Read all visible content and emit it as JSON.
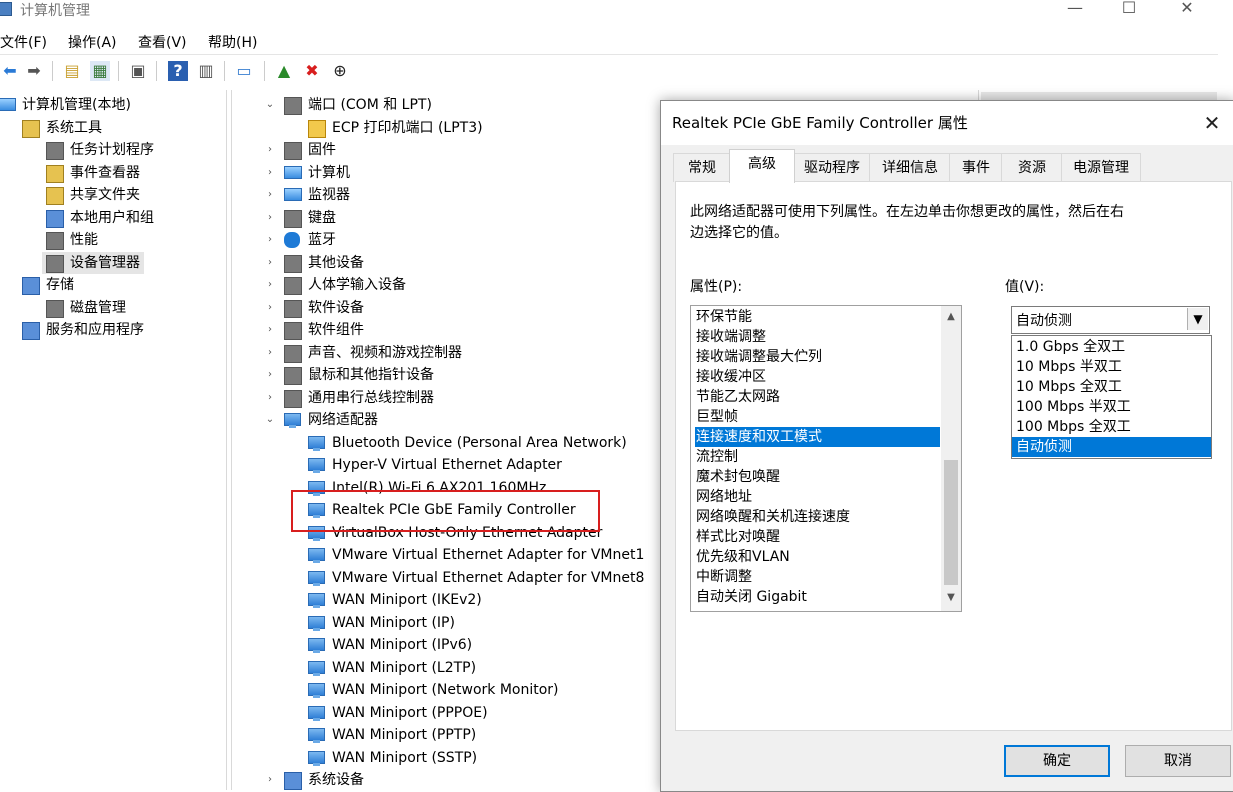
{
  "window": {
    "title": "计算机管理"
  },
  "menu": [
    "文件(F)",
    "操作(A)",
    "查看(V)",
    "帮助(H)"
  ],
  "tree_left": [
    {
      "label": "计算机管理(本地)",
      "level": 0,
      "expander": "",
      "icon": "computer-management-icon"
    },
    {
      "label": "系统工具",
      "level": 1,
      "expander": "⌄",
      "icon": "system-tools-icon"
    },
    {
      "label": "任务计划程序",
      "level": 2,
      "expander": "›",
      "icon": "clock-icon"
    },
    {
      "label": "事件查看器",
      "level": 2,
      "expander": "›",
      "icon": "event-viewer-icon"
    },
    {
      "label": "共享文件夹",
      "level": 2,
      "expander": "›",
      "icon": "shared-folder-icon"
    },
    {
      "label": "本地用户和组",
      "level": 2,
      "expander": "›",
      "icon": "users-icon"
    },
    {
      "label": "性能",
      "level": 2,
      "expander": "›",
      "icon": "performance-icon"
    },
    {
      "label": "设备管理器",
      "level": 2,
      "expander": "",
      "icon": "device-manager-icon",
      "selected": true
    },
    {
      "label": "存储",
      "level": 1,
      "expander": "⌄",
      "icon": "storage-icon"
    },
    {
      "label": "磁盘管理",
      "level": 2,
      "expander": "",
      "icon": "disk-icon"
    },
    {
      "label": "服务和应用程序",
      "level": 1,
      "expander": "›",
      "icon": "services-icon"
    }
  ],
  "tree_center": [
    {
      "label": "端口 (COM 和 LPT)",
      "level": 0,
      "expander": "⌄",
      "icon": "port-icon"
    },
    {
      "label": "ECP 打印机端口 (LPT3)",
      "level": 1,
      "expander": "",
      "icon": "warning-port-icon"
    },
    {
      "label": "固件",
      "level": 0,
      "expander": "›",
      "icon": "firmware-icon"
    },
    {
      "label": "计算机",
      "level": 0,
      "expander": "›",
      "icon": "computer-icon"
    },
    {
      "label": "监视器",
      "level": 0,
      "expander": "›",
      "icon": "monitor-icon"
    },
    {
      "label": "键盘",
      "level": 0,
      "expander": "›",
      "icon": "keyboard-icon"
    },
    {
      "label": "蓝牙",
      "level": 0,
      "expander": "›",
      "icon": "bluetooth-icon"
    },
    {
      "label": "其他设备",
      "level": 0,
      "expander": "›",
      "icon": "other-devices-icon"
    },
    {
      "label": "人体学输入设备",
      "level": 0,
      "expander": "›",
      "icon": "hid-icon"
    },
    {
      "label": "软件设备",
      "level": 0,
      "expander": "›",
      "icon": "software-device-icon"
    },
    {
      "label": "软件组件",
      "level": 0,
      "expander": "›",
      "icon": "software-component-icon"
    },
    {
      "label": "声音、视频和游戏控制器",
      "level": 0,
      "expander": "›",
      "icon": "sound-icon"
    },
    {
      "label": "鼠标和其他指针设备",
      "level": 0,
      "expander": "›",
      "icon": "mouse-icon"
    },
    {
      "label": "通用串行总线控制器",
      "level": 0,
      "expander": "›",
      "icon": "usb-icon"
    },
    {
      "label": "网络适配器",
      "level": 0,
      "expander": "⌄",
      "icon": "network-adapter-icon"
    },
    {
      "label": "Bluetooth Device (Personal Area Network)",
      "level": 1,
      "expander": "",
      "icon": "network-adapter-icon"
    },
    {
      "label": "Hyper-V Virtual Ethernet Adapter",
      "level": 1,
      "expander": "",
      "icon": "network-adapter-icon"
    },
    {
      "label": "Intel(R) Wi-Fi 6 AX201 160MHz",
      "level": 1,
      "expander": "",
      "icon": "network-adapter-icon"
    },
    {
      "label": "Realtek PCIe GbE Family Controller",
      "level": 1,
      "expander": "",
      "icon": "network-adapter-icon"
    },
    {
      "label": "VirtualBox Host-Only Ethernet Adapter",
      "level": 1,
      "expander": "",
      "icon": "network-adapter-icon"
    },
    {
      "label": "VMware Virtual Ethernet Adapter for VMnet1",
      "level": 1,
      "expander": "",
      "icon": "network-adapter-icon"
    },
    {
      "label": "VMware Virtual Ethernet Adapter for VMnet8",
      "level": 1,
      "expander": "",
      "icon": "network-adapter-icon"
    },
    {
      "label": "WAN Miniport (IKEv2)",
      "level": 1,
      "expander": "",
      "icon": "network-adapter-icon"
    },
    {
      "label": "WAN Miniport (IP)",
      "level": 1,
      "expander": "",
      "icon": "network-adapter-icon"
    },
    {
      "label": "WAN Miniport (IPv6)",
      "level": 1,
      "expander": "",
      "icon": "network-adapter-icon"
    },
    {
      "label": "WAN Miniport (L2TP)",
      "level": 1,
      "expander": "",
      "icon": "network-adapter-icon"
    },
    {
      "label": "WAN Miniport (Network Monitor)",
      "level": 1,
      "expander": "",
      "icon": "network-adapter-icon"
    },
    {
      "label": "WAN Miniport (PPPOE)",
      "level": 1,
      "expander": "",
      "icon": "network-adapter-icon"
    },
    {
      "label": "WAN Miniport (PPTP)",
      "level": 1,
      "expander": "",
      "icon": "network-adapter-icon"
    },
    {
      "label": "WAN Miniport (SSTP)",
      "level": 1,
      "expander": "",
      "icon": "network-adapter-icon"
    },
    {
      "label": "系统设备",
      "level": 0,
      "expander": "›",
      "icon": "system-device-icon"
    }
  ],
  "dialog": {
    "title": "Realtek PCIe GbE Family Controller 属性",
    "tabs": [
      "常规",
      "高级",
      "驱动程序",
      "详细信息",
      "事件",
      "资源",
      "电源管理"
    ],
    "active_tab": "高级",
    "description_line1": "此网络适配器可使用下列属性。在左边单击你想更改的属性，然后在右",
    "description_line2": "边选择它的值。",
    "property_label": "属性(P):",
    "value_label": "值(V):",
    "properties": [
      "环保节能",
      "接收端调整",
      "接收端调整最大伫列",
      "接收缓冲区",
      "节能乙太网路",
      "巨型帧",
      "连接速度和双工模式",
      "流控制",
      "魔术封包唤醒",
      "网络地址",
      "网络唤醒和关机连接速度",
      "样式比对唤醒",
      "优先级和VLAN",
      "中断调整",
      "自动关闭 Gigabit"
    ],
    "selected_property": "连接速度和双工模式",
    "value": "自动侦测",
    "options": [
      "1.0 Gbps 全双工",
      "10 Mbps 半双工",
      "10 Mbps 全双工",
      "100 Mbps 半双工",
      "100 Mbps 全双工",
      "自动侦测"
    ],
    "ok_label": "确定",
    "cancel_label": "取消"
  },
  "colors": {
    "selection": "#0078d7",
    "highlight_box": "#d81e1e"
  }
}
